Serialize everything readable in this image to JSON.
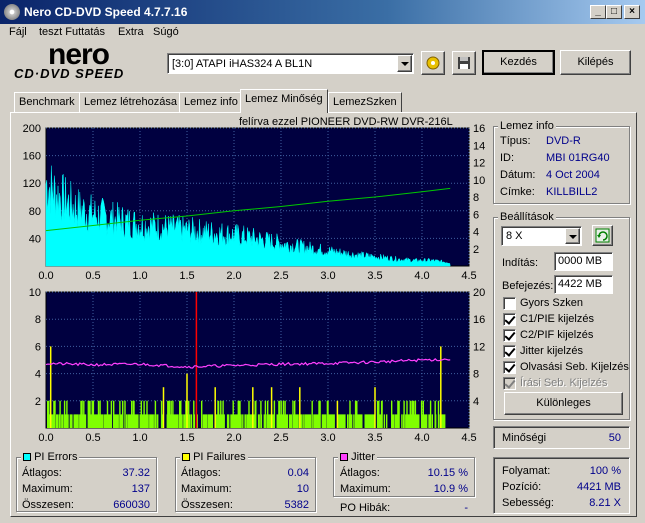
{
  "window": {
    "title": "Nero CD-DVD Speed 4.7.7.16"
  },
  "menu": [
    "Fájl",
    "teszt Futtatás",
    "Extra",
    "Súgó"
  ],
  "logo": {
    "line1": "nero",
    "line2": "CD·DVD SPEED"
  },
  "toolbar": {
    "drive": "[3:0]  ATAPI iHAS324   A BL1N",
    "start_label": "Kezdés",
    "exit_label": "Kilépés"
  },
  "tabs": [
    "Benchmark",
    "Lemez létrehozása",
    "Lemez info",
    "Lemez Minőség",
    "LemezSzken"
  ],
  "active_tab": 3,
  "chart_caption": "felírva ezzel PIONEER  DVD-RW  DVR-216L",
  "colors": {
    "bg": "#000040",
    "pie": "#00ffff",
    "speed": "#00c800",
    "pif": "#80ff00",
    "jitter": "#ff40ff",
    "spike": "#ff0000",
    "yellow": "#ffff00"
  },
  "chart_data": [
    {
      "type": "area",
      "name": "top",
      "xlim": [
        0,
        4.5
      ],
      "ylim": [
        0,
        200
      ],
      "ylim_right": [
        0,
        16
      ],
      "x_ticks": [
        "0.0",
        "0.5",
        "1.0",
        "1.5",
        "2.0",
        "2.5",
        "3.0",
        "3.5",
        "4.0",
        "4.5"
      ],
      "y_ticks": [
        "200",
        "160",
        "120",
        "80",
        "40"
      ],
      "y_ticks_right": [
        "16",
        "14",
        "12",
        "10",
        "8",
        "6",
        "4",
        "2"
      ],
      "series": [
        {
          "x": [
            0,
            0.1,
            0.3,
            0.5,
            0.8,
            1.0,
            1.3,
            1.6,
            2.0,
            2.3,
            2.6,
            3.0,
            3.3,
            3.6,
            3.9,
            4.1,
            4.3
          ],
          "values": [
            120,
            105,
            85,
            75,
            65,
            60,
            55,
            50,
            45,
            38,
            30,
            22,
            16,
            12,
            8,
            8,
            5
          ]
        },
        {
          "x": [
            0,
            0.5,
            1.0,
            1.5,
            2.0,
            2.5,
            3.0,
            3.5,
            4.0,
            4.3
          ],
          "values": [
            4.1,
            4.7,
            5.3,
            5.8,
            6.4,
            6.9,
            7.5,
            8.0,
            8.6,
            9.0
          ]
        }
      ]
    },
    {
      "type": "bar",
      "name": "bottom",
      "xlim": [
        0,
        4.5
      ],
      "ylim": [
        0,
        10
      ],
      "ylim_right": [
        0,
        20
      ],
      "x_ticks": [
        "0.0",
        "0.5",
        "1.0",
        "1.5",
        "2.0",
        "2.5",
        "3.0",
        "3.5",
        "4.0",
        "4.5"
      ],
      "y_ticks": [
        "10",
        "8",
        "6",
        "4",
        "2"
      ],
      "y_ticks_right": [
        "20",
        "16",
        "12",
        "8",
        "4"
      ],
      "series": [
        {
          "x": [
            0.05,
            1.25,
            1.5,
            1.6,
            1.8,
            2.2,
            2.4,
            2.7,
            3.1,
            3.5,
            4.2
          ],
          "values": [
            6,
            3,
            4,
            10,
            3,
            3,
            3,
            3,
            2,
            3,
            6
          ]
        },
        {
          "x": [
            0,
            0.5,
            1.0,
            1.5,
            2.0,
            2.5,
            3.0,
            3.5,
            4.0,
            4.3
          ],
          "values": [
            9.5,
            9.3,
            9.4,
            9.0,
            9.2,
            9.4,
            9.5,
            9.7,
            10.0,
            10.1
          ]
        }
      ]
    }
  ],
  "disc_info": {
    "title": "Lemez info",
    "rows": [
      {
        "label": "Típus:",
        "value": "DVD-R"
      },
      {
        "label": "ID:",
        "value": "MBI 01RG40"
      },
      {
        "label": "Dátum:",
        "value": "4 Oct 2004"
      },
      {
        "label": "Címke:",
        "value": "KILLBILL2"
      }
    ]
  },
  "settings": {
    "title": "Beállítások",
    "speed": "8 X",
    "start_label": "Indítás:",
    "start_value": "0000 MB",
    "end_label": "Befejezés:",
    "end_value": "4422 MB",
    "checkboxes": [
      {
        "label": "Gyors Szken",
        "checked": false,
        "disabled": false
      },
      {
        "label": "C1/PIE kijelzés",
        "checked": true,
        "disabled": false
      },
      {
        "label": "C2/PIF kijelzés",
        "checked": true,
        "disabled": false
      },
      {
        "label": "Jitter kijelzés",
        "checked": true,
        "disabled": false
      },
      {
        "label": "Olvasási Seb. Kijelzés",
        "checked": true,
        "disabled": false
      },
      {
        "label": "Írási Seb. Kijelzés",
        "checked": true,
        "disabled": true
      }
    ],
    "special_label": "Különleges"
  },
  "quality": {
    "label": "Minőségi",
    "value": "50"
  },
  "pi_errors": {
    "title": "PI Errors",
    "avg_label": "Átlagos:",
    "avg": "37.32",
    "max_label": "Maximum:",
    "max": "137",
    "total_label": "Összesen:",
    "total": "660030"
  },
  "pi_failures": {
    "title": "PI Failures",
    "avg_label": "Átlagos:",
    "avg": "0.04",
    "max_label": "Maximum:",
    "max": "10",
    "total_label": "Összesen:",
    "total": "5382"
  },
  "jitter": {
    "title": "Jitter",
    "avg_label": "Átlagos:",
    "avg": "10.15 %",
    "max_label": "Maximum:",
    "max": "10.9 %",
    "po_label": "PO Hibák:",
    "po": "-"
  },
  "progress": {
    "progress_label": "Folyamat:",
    "progress": "100 %",
    "position_label": "Pozíció:",
    "position": "4421 MB",
    "speed_label": "Sebesség:",
    "speed": "8.21 X"
  }
}
